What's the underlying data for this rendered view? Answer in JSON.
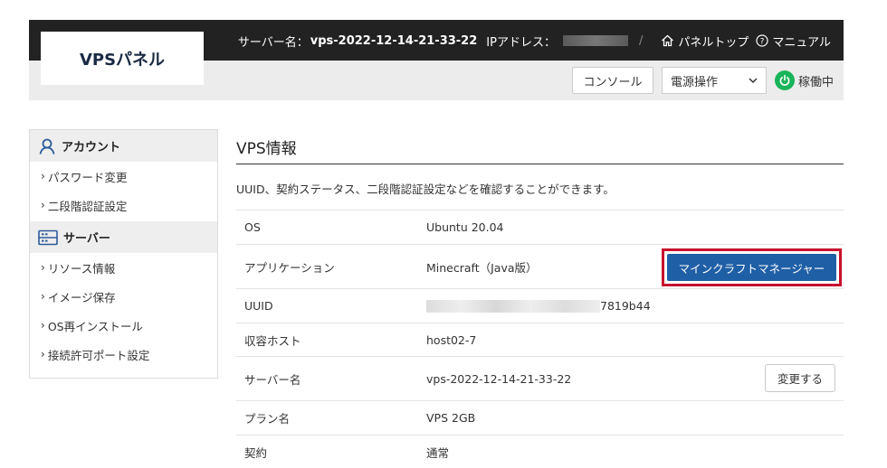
{
  "header": {
    "logo": "VPSパネル",
    "server_label": "サーバー名：",
    "server_name": "vps-2022-12-14-21-33-22",
    "ip_label": "IPアドレス：",
    "separator": "/",
    "panel_top": "パネルトップ",
    "manual": "マニュアル"
  },
  "toolbar": {
    "console": "コンソール",
    "power_select": "電源操作",
    "status": "稼働中",
    "status_color": "#19b45a"
  },
  "sidebar": {
    "sections": [
      {
        "title": "アカウント",
        "icon": "user-icon",
        "items": [
          "パスワード変更",
          "二段階認証設定"
        ]
      },
      {
        "title": "サーバー",
        "icon": "server-icon",
        "items": [
          "リソース情報",
          "イメージ保存",
          "OS再インストール",
          "接続許可ポート設定"
        ]
      }
    ]
  },
  "main": {
    "title": "VPS情報",
    "description": "UUID、契約ステータス、二段階認証設定などを確認することができます。",
    "rows": [
      {
        "key": "OS",
        "value": "Ubuntu 20.04"
      },
      {
        "key": "アプリケーション",
        "value": "Minecraft（Java版）"
      },
      {
        "key": "UUID",
        "value": "7819b44"
      },
      {
        "key": "収容ホスト",
        "value": "host02-7"
      },
      {
        "key": "サーバー名",
        "value": "vps-2022-12-14-21-33-22"
      },
      {
        "key": "プラン名",
        "value": "VPS 2GB"
      },
      {
        "key": "契約",
        "value": "通常"
      }
    ],
    "minecraft_button": "マインクラフトマネージャー",
    "change_button": "変更する",
    "accent_color": "#1f5fa6",
    "highlight_color": "#c8102e"
  }
}
